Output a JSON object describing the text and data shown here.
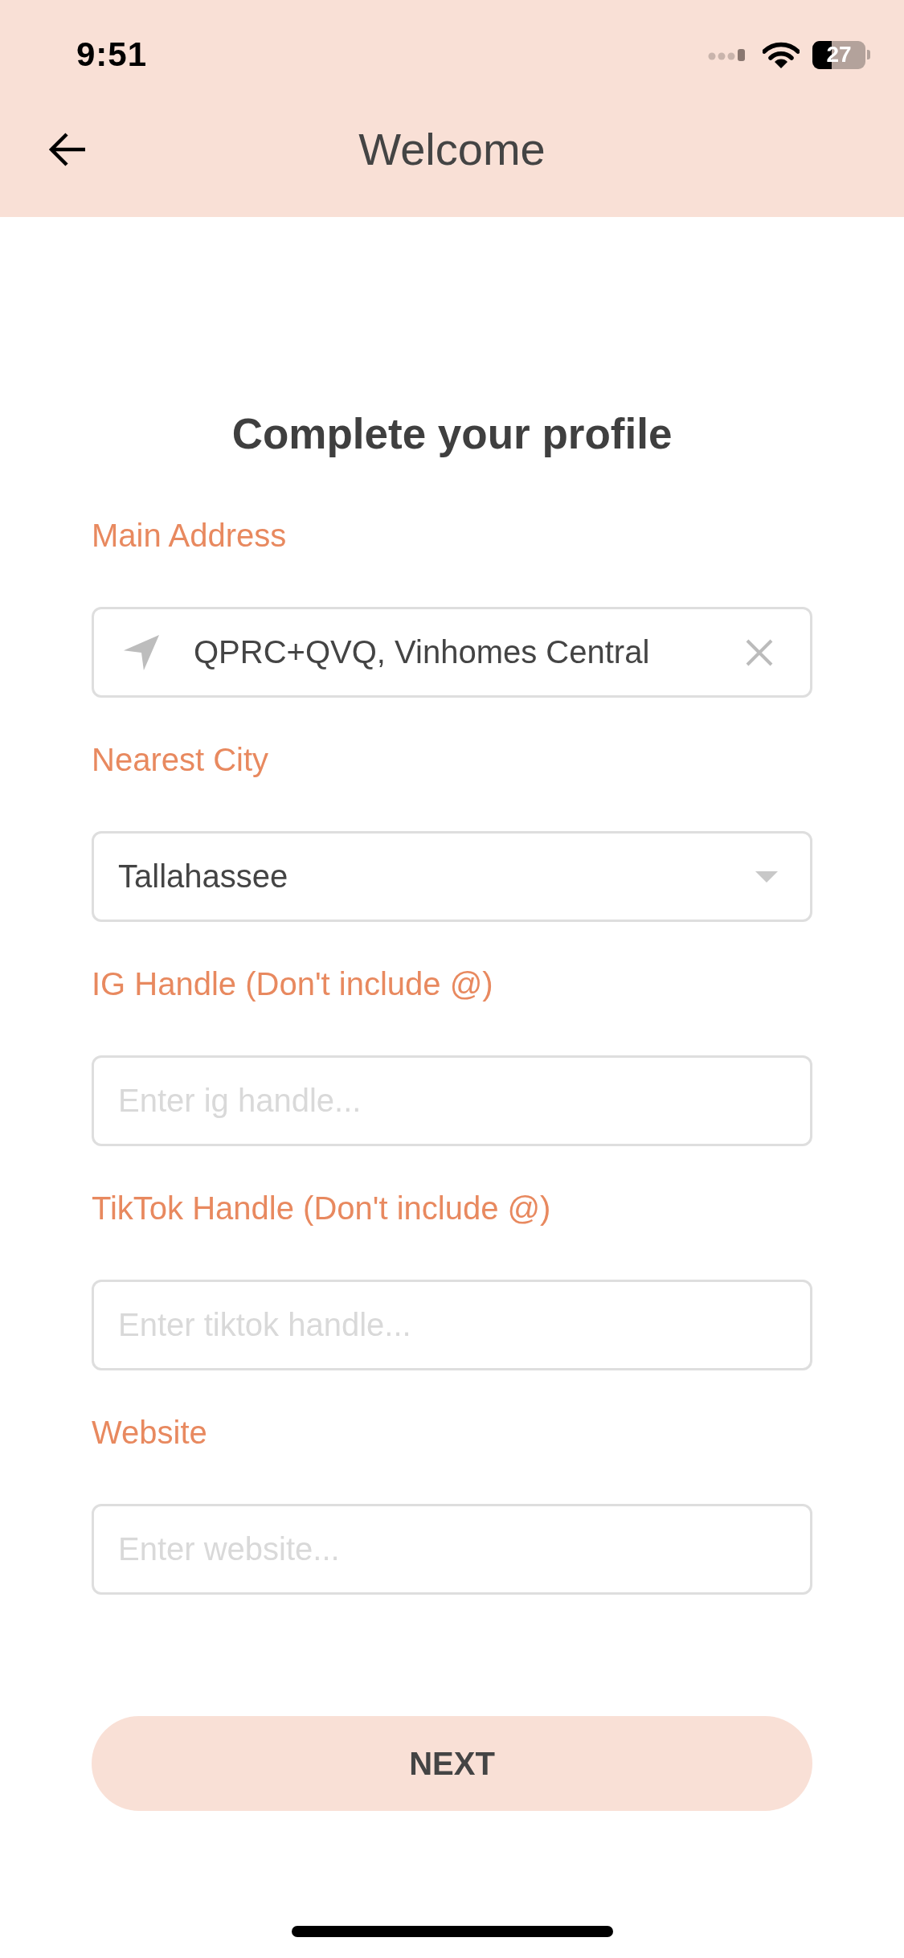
{
  "status_bar": {
    "time": "9:51",
    "battery": "27"
  },
  "header": {
    "title": "Welcome"
  },
  "form": {
    "heading": "Complete your profile",
    "fields": [
      {
        "kind": "address",
        "label": "Main Address",
        "value": "QPRC+QVQ, Vinhomes Central"
      },
      {
        "kind": "select",
        "label": "Nearest City",
        "value": "Tallahassee"
      },
      {
        "kind": "text",
        "label": "IG Handle (Don't include @)",
        "placeholder": "Enter ig handle..."
      },
      {
        "kind": "text",
        "label": "TikTok Handle (Don't include @)",
        "placeholder": "Enter tiktok handle..."
      },
      {
        "kind": "text",
        "label": "Website",
        "placeholder": "Enter website..."
      }
    ]
  },
  "next_button": {
    "label": "NEXT"
  }
}
